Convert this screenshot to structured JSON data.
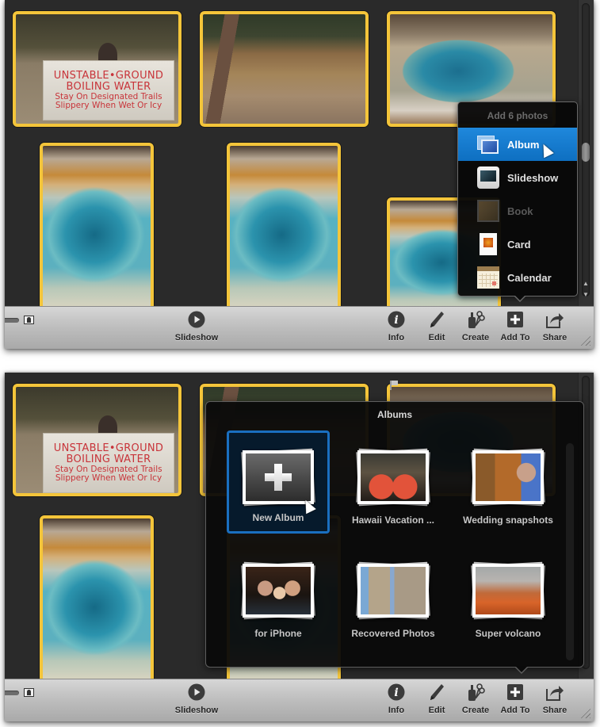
{
  "colors": {
    "selection_border": "#f4c53a",
    "menu_highlight": "#1a7fd3",
    "panel_bg": "#0a0a0a",
    "toolbar_text": "#262626"
  },
  "photos": [
    {
      "id": "sign",
      "description": "Yellowstone warning sign",
      "sign_lines": [
        "UNSTABLE•GROUND",
        "BOILING WATER",
        "Stay On Designated Trails",
        "Slippery When Wet Or Icy"
      ]
    },
    {
      "id": "boardwalk",
      "description": "Boardwalk beside geyser basin"
    },
    {
      "id": "pool",
      "description": "Blue hot spring pool"
    },
    {
      "id": "tall1",
      "description": "Blue hot spring, portrait"
    },
    {
      "id": "tall2",
      "description": "Blue hot spring, portrait"
    },
    {
      "id": "tall3",
      "description": "Blue hot spring, portrait (partial)"
    }
  ],
  "toolbar": {
    "slideshow_label": "Slideshow",
    "buttons": [
      {
        "id": "info",
        "label": "Info",
        "icon": "info-icon"
      },
      {
        "id": "edit",
        "label": "Edit",
        "icon": "pencil-icon"
      },
      {
        "id": "create",
        "label": "Create",
        "icon": "glue-scissors-icon"
      },
      {
        "id": "addto",
        "label": "Add To",
        "icon": "plus-square-icon"
      },
      {
        "id": "share",
        "label": "Share",
        "icon": "share-arrow-icon"
      }
    ]
  },
  "addto_menu": {
    "header": "Add 6 photos",
    "items": [
      {
        "label": "Album",
        "icon": "album-icon",
        "state": "selected"
      },
      {
        "label": "Slideshow",
        "icon": "slideshow-icon",
        "state": "normal"
      },
      {
        "label": "Book",
        "icon": "book-icon",
        "state": "disabled"
      },
      {
        "label": "Card",
        "icon": "card-icon",
        "state": "normal"
      },
      {
        "label": "Calendar",
        "icon": "calendar-icon",
        "state": "normal"
      }
    ]
  },
  "albums_panel": {
    "title": "Albums",
    "albums": [
      {
        "name": "New Album",
        "selected": true
      },
      {
        "name": "Hawaii Vacation ...",
        "selected": false
      },
      {
        "name": "Wedding snapshots",
        "selected": false
      },
      {
        "name": "for iPhone",
        "selected": false
      },
      {
        "name": "Recovered Photos",
        "selected": false
      },
      {
        "name": "Super volcano",
        "selected": false
      }
    ]
  }
}
